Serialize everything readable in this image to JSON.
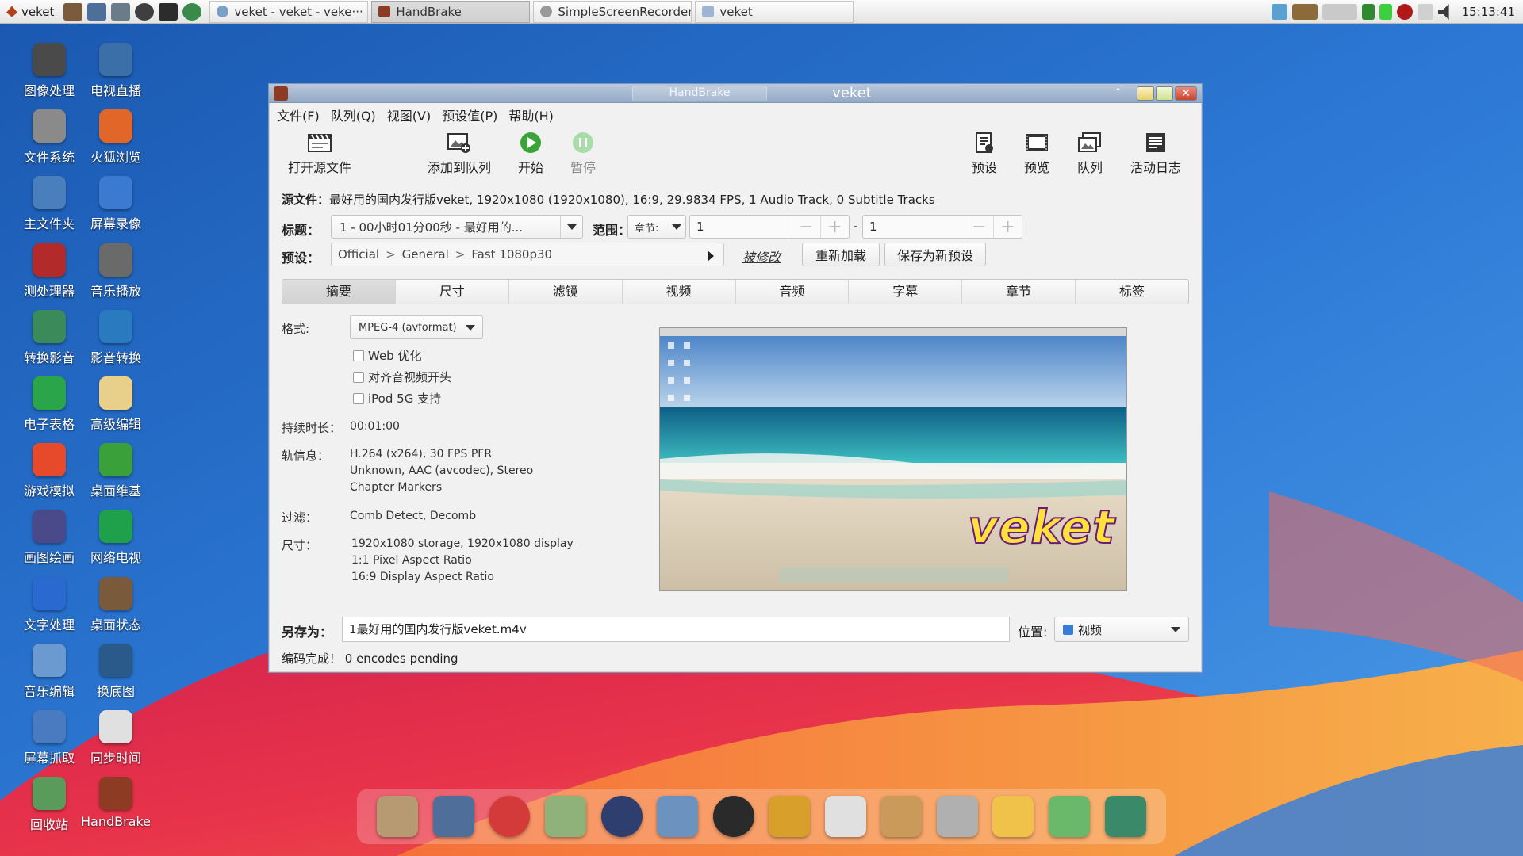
{
  "taskbar": {
    "start_label": "veket",
    "tasks": [
      {
        "label": "veket - veket - veke···"
      },
      {
        "label": "HandBrake"
      },
      {
        "label": "SimpleScreenRecorder"
      },
      {
        "label": "veket"
      }
    ],
    "clock": "15:13:41"
  },
  "desktop": {
    "icons": [
      {
        "label": "图像处理"
      },
      {
        "label": "电视直播"
      },
      {
        "label": "文件系统"
      },
      {
        "label": "火狐浏览"
      },
      {
        "label": "主文件夹"
      },
      {
        "label": "屏幕录像"
      },
      {
        "label": "测处理器"
      },
      {
        "label": "音乐播放"
      },
      {
        "label": "转换影音"
      },
      {
        "label": "影音转换"
      },
      {
        "label": "电子表格"
      },
      {
        "label": "高级编辑"
      },
      {
        "label": "游戏模拟"
      },
      {
        "label": "桌面维基"
      },
      {
        "label": "画图绘画"
      },
      {
        "label": "网络电视"
      },
      {
        "label": "文字处理"
      },
      {
        "label": "桌面状态"
      },
      {
        "label": "音乐编辑"
      },
      {
        "label": "换底图"
      },
      {
        "label": "屏幕抓取"
      },
      {
        "label": "同步时间"
      },
      {
        "label": "回收站"
      },
      {
        "label": "HandBrake"
      }
    ]
  },
  "window": {
    "title_tab": "HandBrake",
    "title": "veket",
    "menu": [
      "文件(F)",
      "队列(Q)",
      "视图(V)",
      "预设值(P)",
      "帮助(H)"
    ],
    "toolbar": {
      "open_source": "打开源文件",
      "add_queue": "添加到队列",
      "start": "开始",
      "pause": "暂停",
      "presets": "预设",
      "preview": "预览",
      "queue": "队列",
      "activity_log": "活动日志"
    },
    "source": {
      "label": "源文件：",
      "value": "最好用的国内发行版veket,  1920x1080 (1920x1080),  16:9,  29.9834 FPS,  1 Audio Track,  0 Subtitle Tracks"
    },
    "title_row": {
      "label": "标题：",
      "value": "1 - 00小时01分00秒 - 最好用的...",
      "range_label": "范围：",
      "range_type": "章节:",
      "range_start": "1",
      "range_sep": "-",
      "range_end": "1"
    },
    "preset_row": {
      "label": "预设：",
      "path": [
        "Official",
        "General",
        "Fast 1080p30"
      ],
      "modified": "被修改",
      "reload": "重新加载",
      "save_new": "保存为新预设"
    },
    "tabs": [
      "摘要",
      "尺寸",
      "滤镜",
      "视频",
      "音频",
      "字幕",
      "章节",
      "标签"
    ],
    "summary": {
      "format_label": "格式:",
      "format_value": "MPEG-4 (avformat)",
      "web_optimize": "Web 优化",
      "align_av": "对齐音视频开头",
      "ipod": "iPod 5G 支持",
      "duration_label": "持续时长：",
      "duration_value": "00:01:00",
      "tracks_label": "轨信息：",
      "tracks_lines": [
        "H.264 (x264), 30 FPS PFR",
        "Unknown, AAC (avcodec), Stereo",
        "Chapter Markers"
      ],
      "filters_label": "过滤：",
      "filters_value": "Comb Detect, Decomb",
      "size_label": "尺寸：",
      "size_lines": [
        "1920x1080 storage, 1920x1080 display",
        "1:1 Pixel Aspect Ratio",
        "16:9 Display Aspect Ratio"
      ]
    },
    "preview": {
      "brand_text": "veket"
    },
    "save_as": {
      "label": "另存为：",
      "value": "1最好用的国内发行版veket.m4v",
      "location_label": "位置:",
      "location_value": "视频"
    },
    "status": "编码完成！ 0 encodes pending"
  },
  "colors": {
    "titlebar": "#93a9c6",
    "start_green": "#3aa33a",
    "pause_green": "#a8dca8",
    "brand_yellow": "#ffe13b"
  }
}
